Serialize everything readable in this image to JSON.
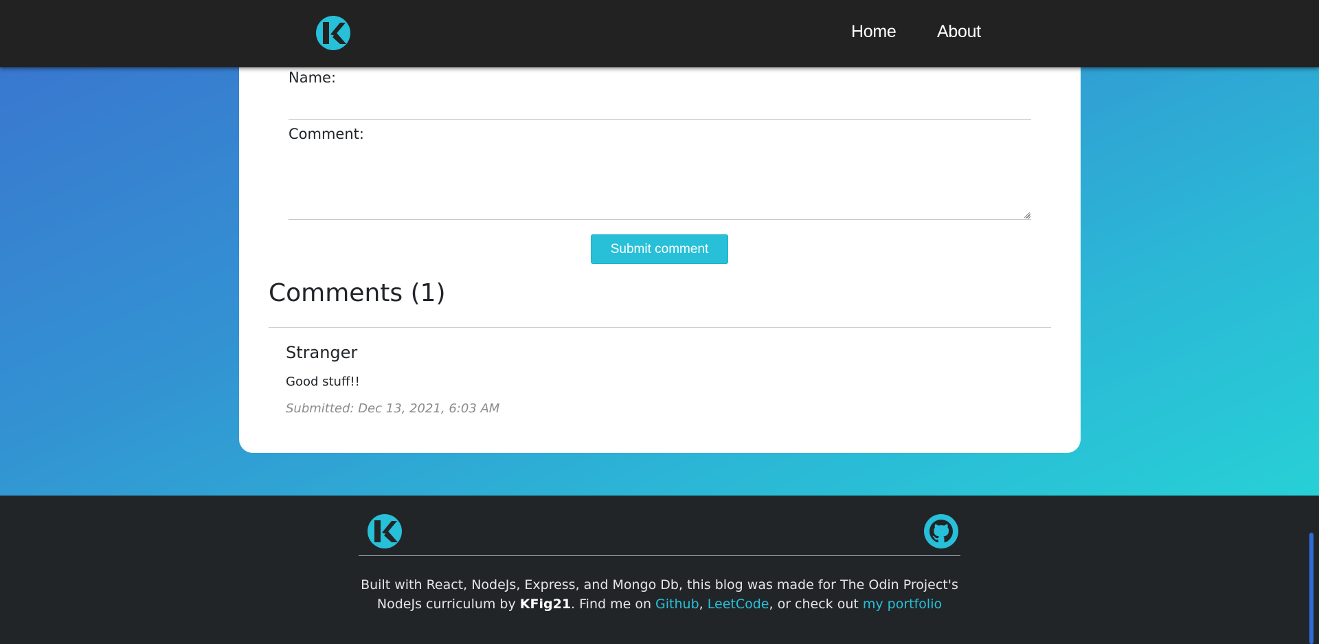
{
  "nav": {
    "home_label": "Home",
    "about_label": "About"
  },
  "form": {
    "name_label": "Name:",
    "name_value": "",
    "comment_label": "Comment:",
    "comment_value": "",
    "submit_label": "Submit comment"
  },
  "comments": {
    "heading": "Comments (1)",
    "items": [
      {
        "author": "Stranger",
        "body": "Good stuff!!",
        "submitted": "Submitted: Dec 13, 2021, 6:03 AM"
      }
    ]
  },
  "footer": {
    "text_1": "Built with React, NodeJs, Express, and Mongo Db, this blog was made for The Odin Project's NodeJs curriculum by ",
    "author": "KFig21",
    "text_2": ". Find me on ",
    "github_link": "Github",
    "sep_1": ", ",
    "leetcode_link": "LeetCode",
    "text_3": ", or check out ",
    "portfolio_link": "my portfolio"
  },
  "colors": {
    "accent": "#27c0d8",
    "nav_bg": "#222222",
    "footer_bg": "#222528",
    "gradient_start": "#3a73cf",
    "gradient_end": "#25dcd6"
  },
  "icons": {
    "site_logo": "kfig-logo-icon",
    "github": "github-icon"
  }
}
